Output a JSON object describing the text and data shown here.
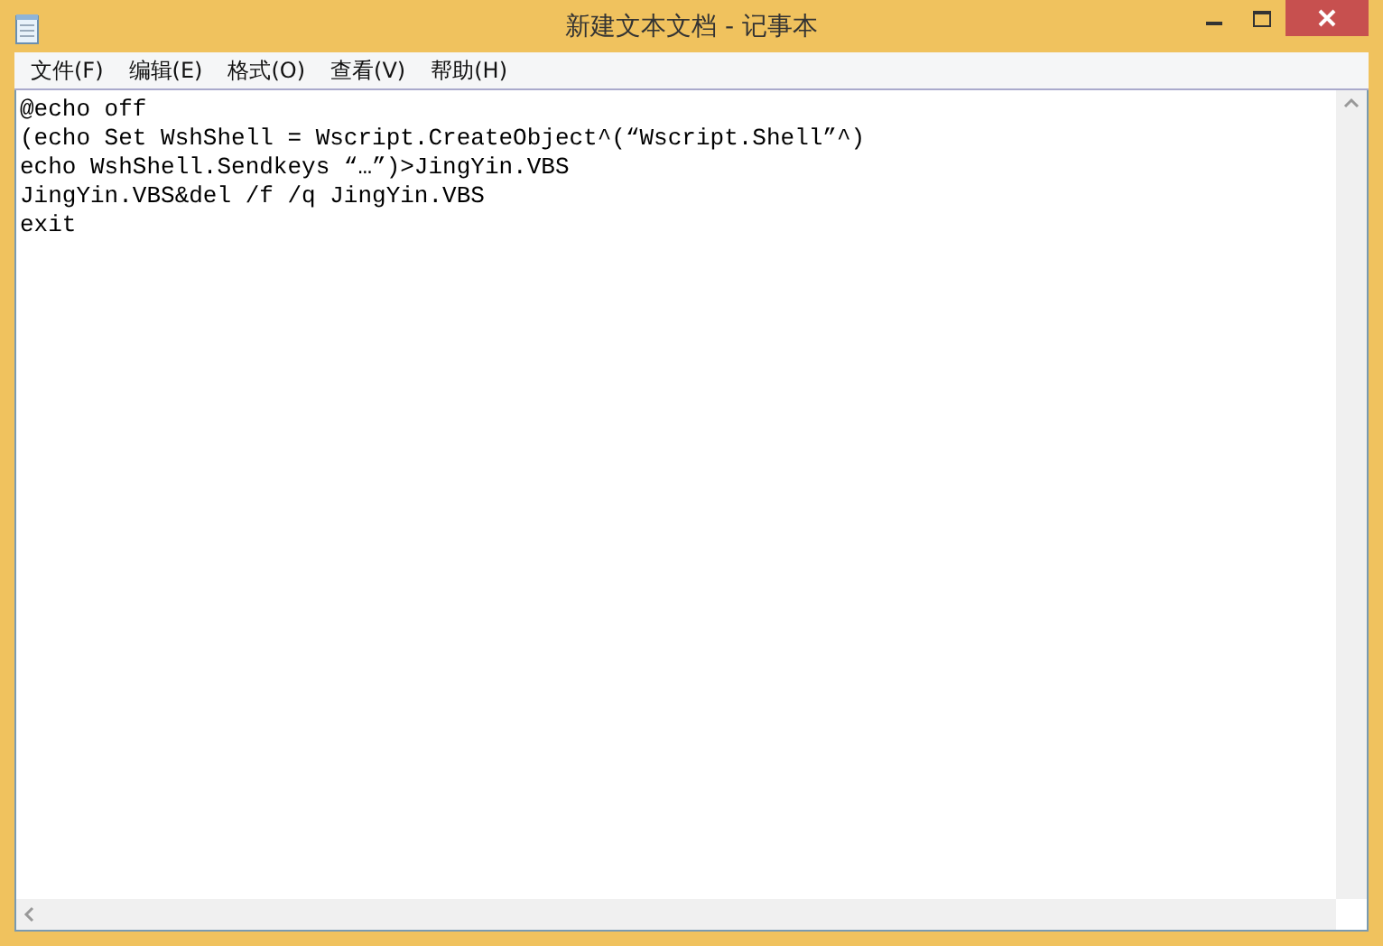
{
  "window": {
    "title": "新建文本文档 - 记事本"
  },
  "menu": [
    {
      "label": "文件(F)"
    },
    {
      "label": "编辑(E)"
    },
    {
      "label": "格式(O)"
    },
    {
      "label": "查看(V)"
    },
    {
      "label": "帮助(H)"
    }
  ],
  "editor": {
    "lines": [
      "@echo off",
      "(echo Set WshShell = Wscript.CreateObject^(“Wscript.Shell”^)",
      "echo WshShell.Sendkeys “…”)>JingYin.VBS",
      "JingYin.VBS&del /f /q JingYin.VBS",
      "exit"
    ]
  }
}
